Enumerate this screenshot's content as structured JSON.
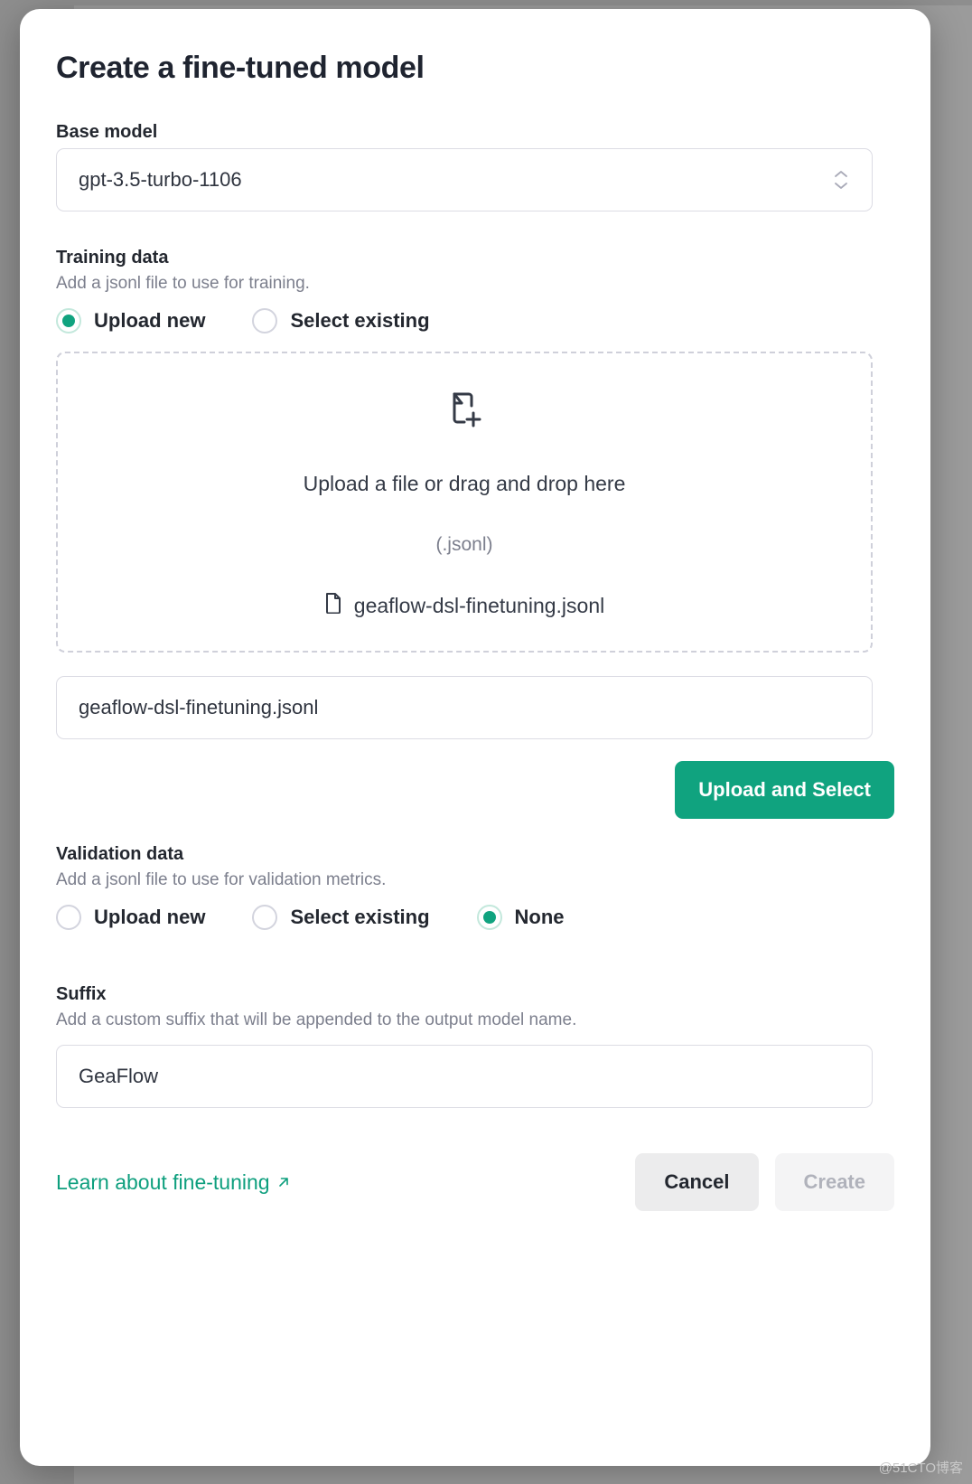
{
  "modal": {
    "title": "Create a fine-tuned model"
  },
  "base_model": {
    "label": "Base model",
    "value": "gpt-3.5-turbo-1106",
    "icon": "chevron-up-down-icon"
  },
  "training_data": {
    "label": "Training data",
    "description": "Add a jsonl file to use for training.",
    "options": [
      {
        "label": "Upload new",
        "selected": true
      },
      {
        "label": "Select existing",
        "selected": false
      }
    ],
    "dropzone": {
      "icon": "file-plus-icon",
      "primary_text": "Upload a file or drag and drop here",
      "secondary_text": "(.jsonl)",
      "file_icon": "file-icon",
      "file_name": "geaflow-dsl-finetuning.jsonl"
    },
    "file_input_value": "geaflow-dsl-finetuning.jsonl",
    "upload_button": "Upload and Select"
  },
  "validation_data": {
    "label": "Validation data",
    "description": "Add a jsonl file to use for validation metrics.",
    "options": [
      {
        "label": "Upload new",
        "selected": false
      },
      {
        "label": "Select existing",
        "selected": false
      },
      {
        "label": "None",
        "selected": true
      }
    ]
  },
  "suffix": {
    "label": "Suffix",
    "description": "Add a custom suffix that will be appended to the output model name.",
    "value": "GeaFlow"
  },
  "footer": {
    "link_label": "Learn about fine-tuning",
    "link_icon": "external-link-icon",
    "cancel_label": "Cancel",
    "create_label": "Create"
  },
  "watermark": "@51CTO博客",
  "colors": {
    "accent_green": "#10a37f",
    "link_green": "#0e9f7e",
    "text_primary": "#23272f",
    "text_muted": "#7c7f8d",
    "border": "#dcdce4"
  }
}
